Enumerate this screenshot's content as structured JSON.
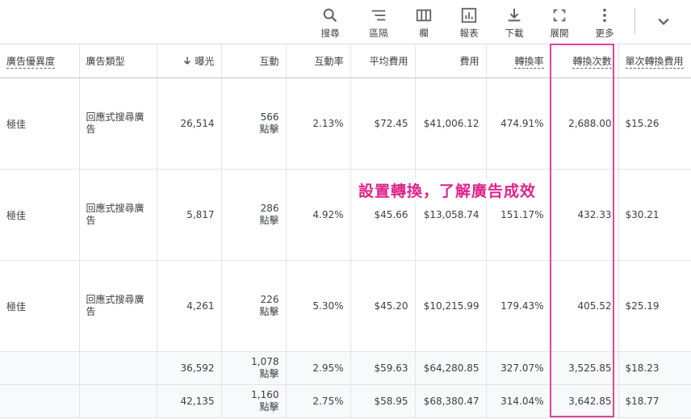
{
  "toolbar": {
    "buttons": [
      {
        "label": "搜尋",
        "icon": "search-icon"
      },
      {
        "label": "區隔",
        "icon": "segment-icon"
      },
      {
        "label": "欄",
        "icon": "columns-icon"
      },
      {
        "label": "報表",
        "icon": "report-icon"
      },
      {
        "label": "下載",
        "icon": "download-icon"
      },
      {
        "label": "展開",
        "icon": "expand-icon"
      },
      {
        "label": "更多",
        "icon": "more-vert-icon"
      }
    ]
  },
  "table": {
    "headers": [
      "廣告優異度",
      "廣告類型",
      "曝光",
      "互動",
      "互動率",
      "平均費用",
      "費用",
      "轉換率",
      "轉換次數",
      "單次轉換費用"
    ],
    "rows": [
      {
        "strength": "極佳",
        "type": "回應式搜尋廣告",
        "impressions": "26,514",
        "interactions": "566",
        "interactions_unit": "點擊",
        "rate": "2.13%",
        "avg_cost": "$72.45",
        "cost": "$41,006.12",
        "conv_rate": "474.91%",
        "conversions": "2,688.00",
        "cost_per_conv": "$15.26"
      },
      {
        "strength": "極佳",
        "type": "回應式搜尋廣告",
        "impressions": "5,817",
        "interactions": "286",
        "interactions_unit": "點擊",
        "rate": "4.92%",
        "avg_cost": "$45.66",
        "cost": "$13,058.74",
        "conv_rate": "151.17%",
        "conversions": "432.33",
        "cost_per_conv": "$30.21"
      },
      {
        "strength": "極佳",
        "type": "回應式搜尋廣告",
        "impressions": "4,261",
        "interactions": "226",
        "interactions_unit": "點擊",
        "rate": "5.30%",
        "avg_cost": "$45.20",
        "cost": "$10,215.99",
        "conv_rate": "179.43%",
        "conversions": "405.52",
        "cost_per_conv": "$25.19"
      }
    ],
    "totals": [
      {
        "impressions": "36,592",
        "interactions": "1,078",
        "interactions_unit": "點擊",
        "rate": "2.95%",
        "avg_cost": "$59.63",
        "cost": "$64,280.85",
        "conv_rate": "327.07%",
        "conversions": "3,525.85",
        "cost_per_conv": "$18.23"
      },
      {
        "impressions": "42,135",
        "interactions": "1,160",
        "interactions_unit": "點擊",
        "rate": "2.75%",
        "avg_cost": "$58.95",
        "cost": "$68,380.47",
        "conv_rate": "314.04%",
        "conversions": "3,642.85",
        "cost_per_conv": "$18.77"
      }
    ]
  },
  "annotation": "設置轉換，了解廣告成效",
  "colors": {
    "highlight": "#e0449a",
    "annotation": "#e0238a"
  }
}
